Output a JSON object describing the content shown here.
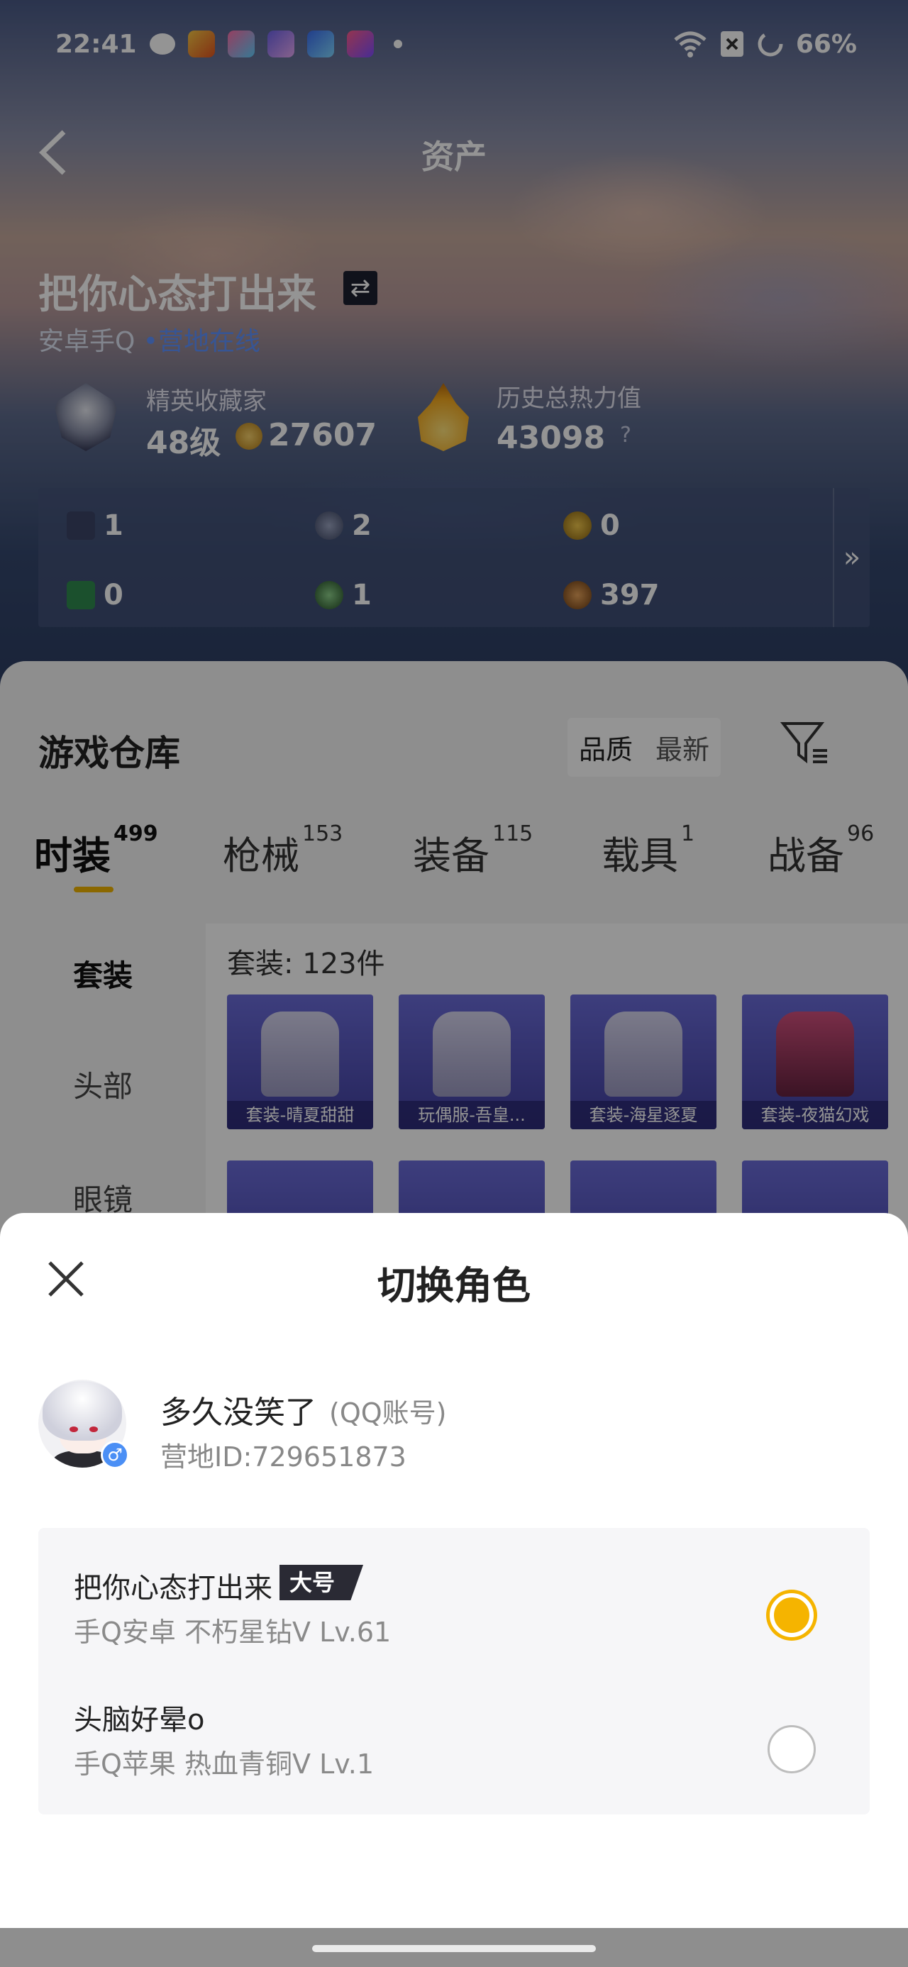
{
  "status_bar": {
    "time": "22:41",
    "battery": "66%",
    "left_icons": [
      "wechat-icon",
      "game-app-icon",
      "photo-app-icon",
      "character-app-icon",
      "game2-app-icon",
      "star-app-icon"
    ],
    "right_icons": [
      "wifi-icon",
      "sim-icon",
      "battery-ring-icon"
    ]
  },
  "nav": {
    "title": "资产",
    "back_icon": "chevron-left-icon"
  },
  "player": {
    "name": "把你心态打出来",
    "platform": "安卓手Q",
    "online_status": "营地在线",
    "rank_label": "精英收藏家",
    "level": "48级",
    "coins": "27607",
    "heat_label": "历史总热力值",
    "heat_value": "43098",
    "help": "?"
  },
  "currencies": [
    {
      "icon": "card-icon",
      "value": "1"
    },
    {
      "icon": "badge-icon",
      "value": "2"
    },
    {
      "icon": "medal-icon",
      "value": "0"
    },
    {
      "icon": "ticket-icon",
      "value": "0"
    },
    {
      "icon": "orb-icon",
      "value": "1"
    },
    {
      "icon": "token-icon",
      "value": "397"
    }
  ],
  "currencies_more": "»",
  "warehouse": {
    "title": "游戏仓库",
    "sort_quality": "品质",
    "sort_latest": "最新",
    "tabs": [
      {
        "label": "时装",
        "count": "499"
      },
      {
        "label": "枪械",
        "count": "153"
      },
      {
        "label": "装备",
        "count": "115"
      },
      {
        "label": "载具",
        "count": "1"
      },
      {
        "label": "战备",
        "count": "96"
      }
    ],
    "side_items": [
      "套装",
      "头部",
      "眼镜"
    ],
    "count_text": "套装: 123件",
    "items": [
      "套装-晴夏甜甜",
      "玩偶服-吾皇...",
      "套装-海星逐夏",
      "套装-夜猫幻戏"
    ]
  },
  "sheet": {
    "title": "切换角色",
    "account_name": "多久没笑了",
    "account_type": "(QQ账号)",
    "camp_id": "营地ID:729651873",
    "gender_symbol": "♂",
    "roles": [
      {
        "name": "把你心态打出来",
        "tag": "大号",
        "sub": "手Q安卓  不朽星钻V  Lv.61",
        "selected": true
      },
      {
        "name": "头脑好晕o",
        "tag": "",
        "sub": "手Q苹果  热血青铜V  Lv.1",
        "selected": false
      }
    ]
  },
  "colors": {
    "accent": "#f5b400",
    "online": "#5f93ff",
    "gender_badge": "#4b8ff5"
  }
}
